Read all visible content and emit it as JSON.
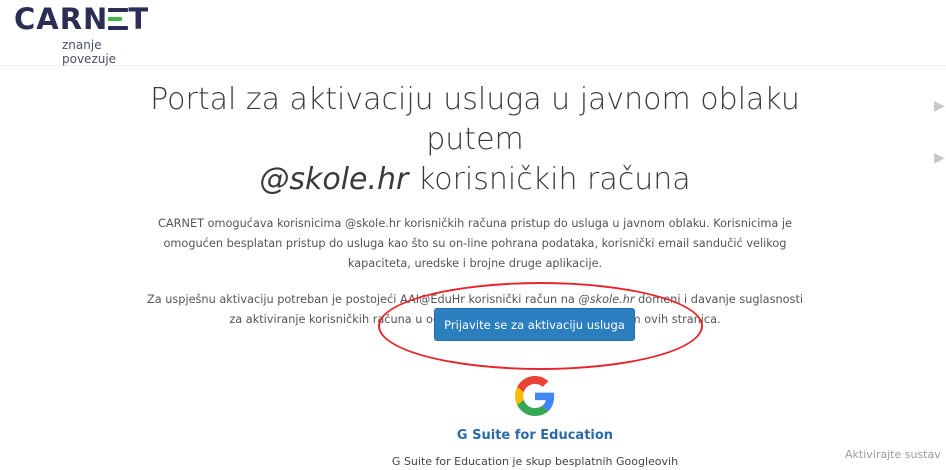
{
  "header": {
    "logo_text_before": "CARN",
    "logo_text_after": "T",
    "logo_tagline": "znanje povezuje",
    "colors": {
      "logo_dark": "#2b2f55",
      "logo_green": "#3fb54a"
    }
  },
  "main": {
    "title_line1": "Portal za aktivaciju usluga u javnom oblaku putem",
    "title_domain": "@skole.hr",
    "title_line2_rest": " korisničkih računa",
    "paragraph1": "CARNET omogućava korisnicima @skole.hr korisničkih računa pristup do usluga u javnom oblaku. Korisnicima je omogućen besplatan pristup do usluga kao što su on-line pohrana podataka, korisnički email sandučić velikog kapaciteta, uredske i brojne druge aplikacije.",
    "paragraph2_part1": "Za uspješnu aktivaciju potreban je postojeći AAI@EduHr korisnički račun na ",
    "paragraph2_domain": "@skole.hr",
    "paragraph2_part2": " domeni i davanje suglasnosti za aktiviranje korisničkih računa u odgovarajućem javnom oblaku putem ovih stranica.",
    "login_button": "Prijavite se za aktivaciju usluga",
    "colors": {
      "button": "#2c7fbf",
      "annotation": "#e8242a"
    }
  },
  "gsuite": {
    "icon": "google-g-icon",
    "title": "G Suite for Education",
    "description": "G Suite for Education je skup besplatnih Googleovih"
  },
  "overlay": {
    "windows_watermark": "Aktivirajte sustav"
  }
}
